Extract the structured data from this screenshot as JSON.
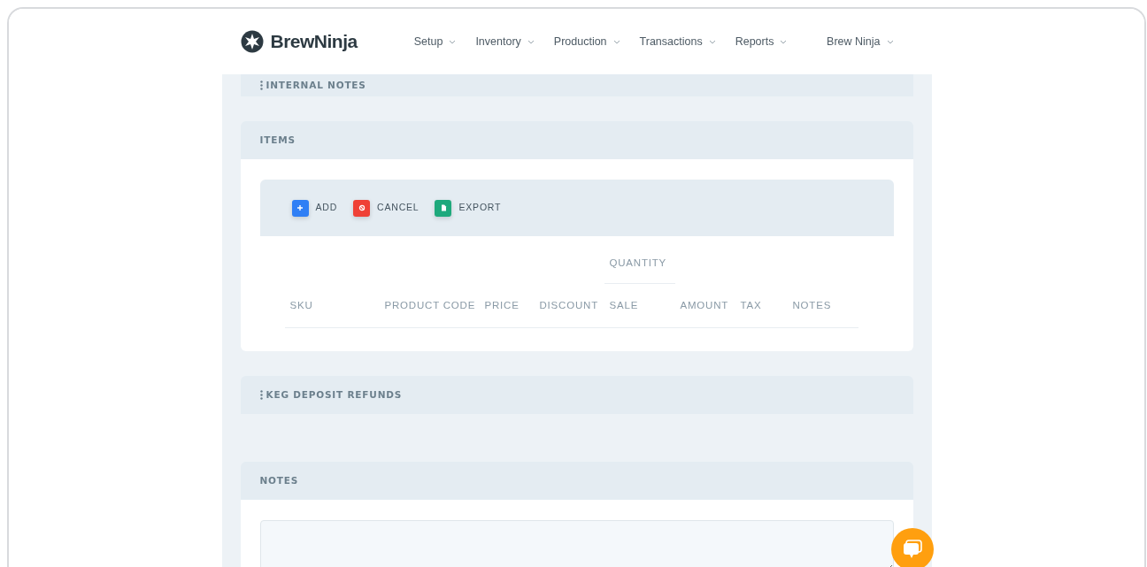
{
  "brand": {
    "name": "BrewNinja"
  },
  "nav": [
    {
      "label": "Setup"
    },
    {
      "label": "Inventory"
    },
    {
      "label": "Production"
    },
    {
      "label": "Transactions"
    },
    {
      "label": "Reports"
    }
  ],
  "account": {
    "label": "Brew Ninja"
  },
  "sections": [
    {
      "kind": "collapsed",
      "title": "INTERNAL NOTES",
      "handle": true
    },
    {
      "kind": "items",
      "title": "ITEMS",
      "handle": false,
      "toolbar": [
        {
          "kind": "add",
          "label": "ADD",
          "color": "#2f7ff5"
        },
        {
          "kind": "cancel",
          "label": "CANCEL",
          "color": "#ef4136"
        },
        {
          "kind": "export",
          "label": "EXPORT",
          "color": "#1ea97c"
        }
      ],
      "table": {
        "columns": [
          {
            "label": "SKU"
          },
          {
            "label": "PRODUCT CODE"
          },
          {
            "label": "PRICE"
          },
          {
            "label": "DISCOUNT"
          },
          {
            "label": "SALE",
            "group": "QUANTITY"
          },
          {
            "label": "AMOUNT"
          },
          {
            "label": "TAX"
          },
          {
            "label": "NOTES"
          }
        ]
      }
    },
    {
      "kind": "collapsed",
      "title": "KEG DEPOSIT REFUNDS",
      "handle": true
    },
    {
      "kind": "notes",
      "title": "NOTES",
      "handle": false
    }
  ]
}
